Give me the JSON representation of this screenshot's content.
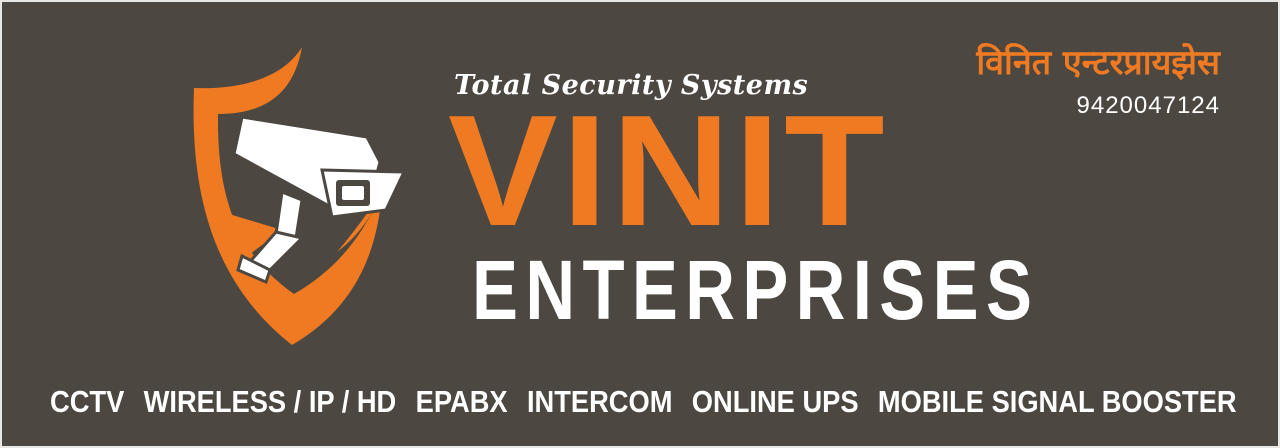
{
  "banner": {
    "tagline": "Total Security Systems",
    "brand_main": "VINIT",
    "brand_sub": "ENTERPRISES",
    "marathi_name": "विनित एन्टरप्रायझेस",
    "phone": "9420047124",
    "services": [
      "CCTV",
      "WIRELESS / IP / HD",
      "EPABX",
      "INTERCOM",
      "ONLINE UPS",
      "MOBILE SIGNAL BOOSTER"
    ]
  },
  "logo": {
    "icon": "security-camera-shield-icon"
  },
  "colors": {
    "background": "#4c4741",
    "accent": "#f07a22",
    "text": "#ffffff"
  }
}
